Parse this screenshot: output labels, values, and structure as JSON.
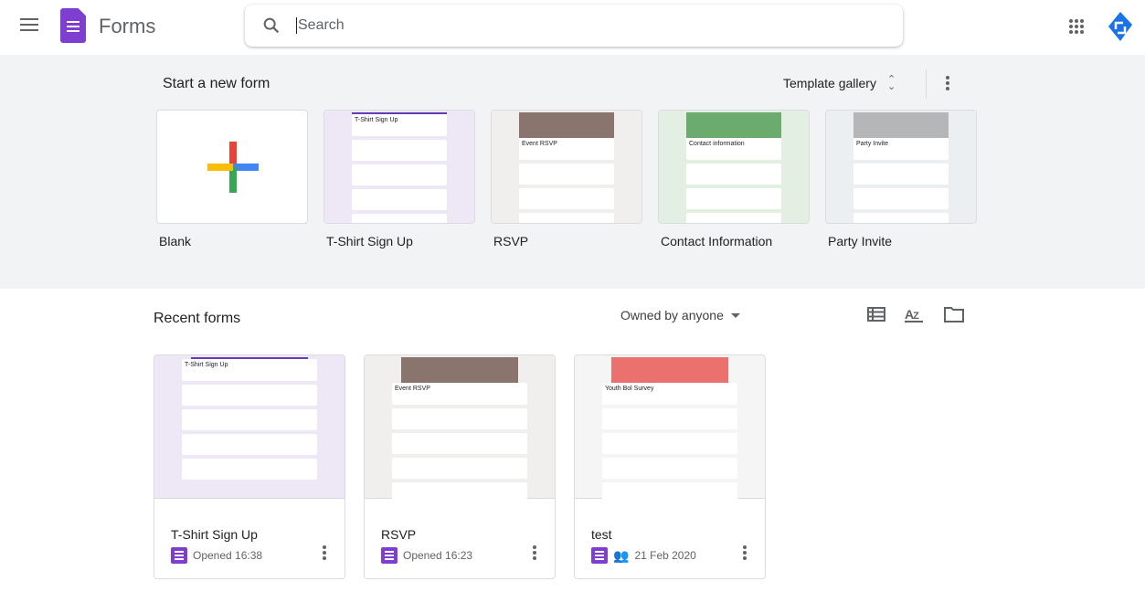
{
  "header": {
    "app_name": "Forms",
    "search_placeholder": "Search"
  },
  "templates": {
    "heading": "Start a new form",
    "gallery_label": "Template gallery",
    "items": [
      {
        "label": "Blank",
        "thumb_title": ""
      },
      {
        "label": "T-Shirt Sign Up",
        "thumb_title": "T-Shirt Sign Up",
        "bg": "#ede7f6",
        "accent": "#673ab7"
      },
      {
        "label": "RSVP",
        "thumb_title": "Event RSVP",
        "bg": "#f1efed",
        "accent": "#5d4037"
      },
      {
        "label": "Contact Information",
        "thumb_title": "Contact information",
        "bg": "#e3efe2",
        "accent": "#388e3c"
      },
      {
        "label": "Party Invite",
        "thumb_title": "Party Invite",
        "bg": "#eceff1",
        "accent": "#9e9e9e"
      }
    ]
  },
  "recent": {
    "heading": "Recent forms",
    "owner_filter": "Owned by anyone",
    "items": [
      {
        "title": "T-Shirt Sign Up",
        "thumb_title": "T-Shirt Sign Up",
        "meta": "Opened 16:38",
        "shared": false,
        "bg": "#ede7f6",
        "accent": "#673ab7"
      },
      {
        "title": "RSVP",
        "thumb_title": "Event RSVP",
        "meta": "Opened 16:23",
        "shared": false,
        "bg": "#f1efed",
        "accent": "#5d4037"
      },
      {
        "title": "test",
        "thumb_title": "Youth Bol Survey",
        "meta": "21 Feb 2020",
        "shared": true,
        "bg": "#f5f5f5",
        "accent": "#e53935"
      }
    ]
  },
  "colors": {
    "forms_purple": "#7e3fd1",
    "band": "#f1f3f4"
  }
}
